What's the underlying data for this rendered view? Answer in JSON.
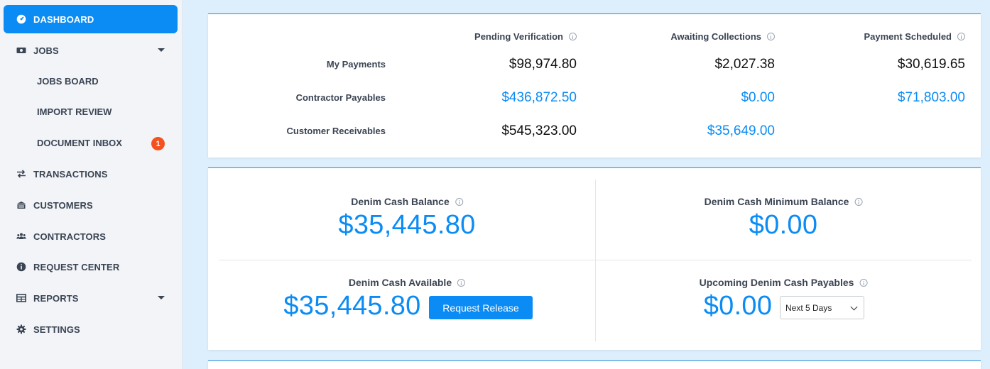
{
  "sidebar": {
    "items": [
      {
        "label": "DASHBOARD",
        "icon": "dashboard-gauge-icon",
        "active": true
      },
      {
        "label": "JOBS",
        "icon": "money-icon",
        "expandable": true
      },
      {
        "label": "TRANSACTIONS",
        "icon": "arrows-exchange-icon"
      },
      {
        "label": "CUSTOMERS",
        "icon": "building-icon"
      },
      {
        "label": "CONTRACTORS",
        "icon": "users-icon"
      },
      {
        "label": "REQUEST CENTER",
        "icon": "info-circle-icon"
      },
      {
        "label": "REPORTS",
        "icon": "table-icon",
        "expandable": true
      },
      {
        "label": "SETTINGS",
        "icon": "gear-icon"
      }
    ],
    "jobs_sub": [
      {
        "label": "JOBS BOARD"
      },
      {
        "label": "IMPORT REVIEW"
      },
      {
        "label": "DOCUMENT INBOX",
        "badge": "1"
      }
    ]
  },
  "summary": {
    "columns": [
      "Pending Verification",
      "Awaiting Collections",
      "Payment Scheduled"
    ],
    "rows": [
      {
        "label": "My Payments",
        "values": [
          "$98,974.80",
          "$2,027.38",
          "$30,619.65"
        ]
      },
      {
        "label": "Contractor Payables",
        "values": [
          "$436,872.50",
          "$0.00",
          "$71,803.00"
        ]
      },
      {
        "label": "Customer Receivables",
        "values": [
          "$545,323.00",
          "$35,649.00",
          ""
        ]
      }
    ]
  },
  "cash": {
    "balance_title": "Denim Cash Balance",
    "balance_value": "$35,445.80",
    "minimum_title": "Denim Cash Minimum Balance",
    "minimum_value": "$0.00",
    "available_title": "Denim Cash Available",
    "available_value": "$35,445.80",
    "request_release_label": "Request Release",
    "upcoming_title": "Upcoming Denim Cash Payables",
    "upcoming_value": "$0.00",
    "period_selected": "Next 5 Days"
  },
  "colors": {
    "accent": "#0b8cf4",
    "badge": "#f5511e",
    "background": "#ddeefc"
  }
}
